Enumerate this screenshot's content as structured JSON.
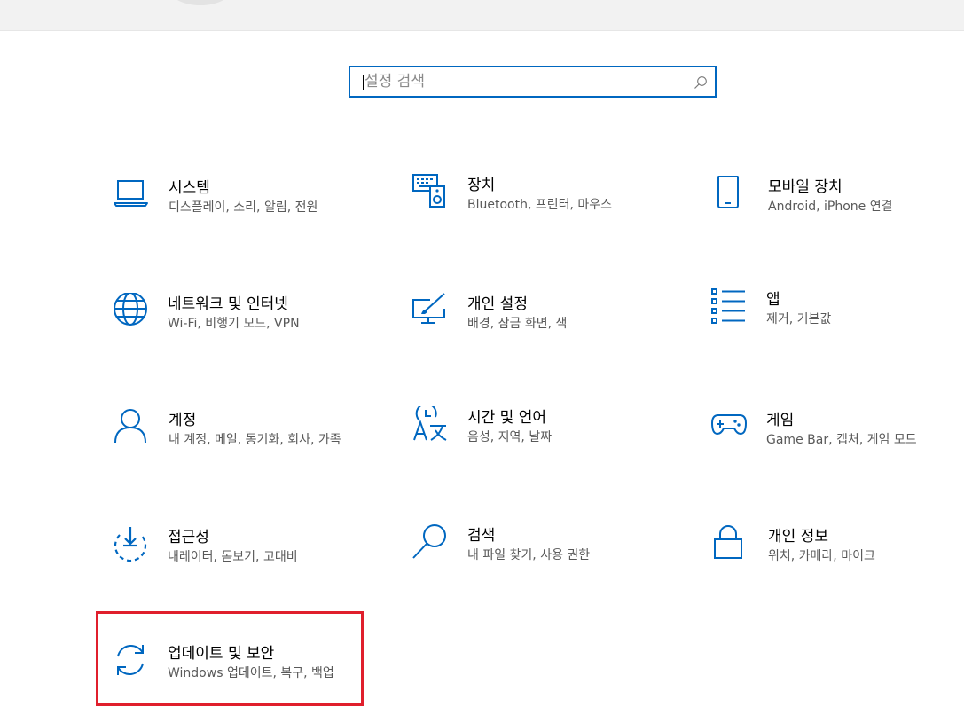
{
  "search": {
    "placeholder": "설정 검색",
    "value": ""
  },
  "tiles": [
    {
      "title": "시스템",
      "subtitle": "디스플레이, 소리, 알림, 전원",
      "icon": "laptop-icon"
    },
    {
      "title": "장치",
      "subtitle": "Bluetooth, 프린터, 마우스",
      "icon": "devices-icon"
    },
    {
      "title": "모바일 장치",
      "subtitle": "Android, iPhone 연결",
      "icon": "phone-icon"
    },
    {
      "title": "네트워크 및 인터넷",
      "subtitle": "Wi-Fi, 비행기 모드, VPN",
      "icon": "globe-icon"
    },
    {
      "title": "개인 설정",
      "subtitle": "배경, 잠금 화면, 색",
      "icon": "personalization-icon"
    },
    {
      "title": "앱",
      "subtitle": "제거, 기본값",
      "icon": "apps-list-icon"
    },
    {
      "title": "계정",
      "subtitle": "내 계정, 메일, 동기화, 회사, 가족",
      "icon": "person-icon"
    },
    {
      "title": "시간 및 언어",
      "subtitle": "음성, 지역, 날짜",
      "icon": "time-language-icon"
    },
    {
      "title": "게임",
      "subtitle": "Game Bar, 캡처, 게임 모드",
      "icon": "gamepad-icon"
    },
    {
      "title": "접근성",
      "subtitle": "내레이터, 돋보기, 고대비",
      "icon": "accessibility-icon"
    },
    {
      "title": "검색",
      "subtitle": "내 파일 찾기, 사용 권한",
      "icon": "search-icon"
    },
    {
      "title": "개인 정보",
      "subtitle": "위치, 카메라, 마이크",
      "icon": "lock-icon"
    },
    {
      "title": "업데이트 및 보안",
      "subtitle": "Windows 업데이트, 복구, 백업",
      "icon": "sync-icon"
    }
  ],
  "colors": {
    "accent": "#0067c0",
    "highlight": "#e01f2c",
    "subtitle": "#595959"
  }
}
